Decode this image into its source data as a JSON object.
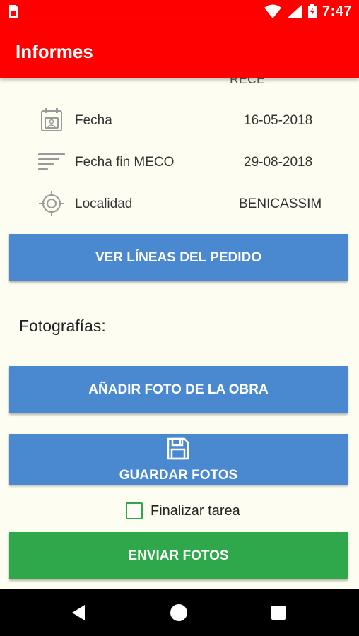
{
  "status_bar": {
    "time": "7:47",
    "icons": [
      "sim-card-icon",
      "wifi-icon",
      "signal-icon",
      "battery-icon"
    ]
  },
  "app_bar": {
    "title": "Informes"
  },
  "partial_text": "RECE",
  "details": [
    {
      "icon": "calendar-icon",
      "label": "Fecha",
      "value": "16-05-2018"
    },
    {
      "icon": "sort-lines-icon",
      "label": "Fecha fin MECO",
      "value": "29-08-2018"
    },
    {
      "icon": "location-target-icon",
      "label": "Localidad",
      "value": "BENICASSIM"
    }
  ],
  "buttons": {
    "ver_lineas": "VER LÍNEAS DEL PEDIDO",
    "anadir_foto": "AÑADIR FOTO DE LA OBRA",
    "guardar_fotos": "GUARDAR FOTOS",
    "enviar_fotos": "ENVIAR FOTOS"
  },
  "photos_section": {
    "title": "Fotografías:"
  },
  "finalizar": {
    "label": "Finalizar tarea",
    "checked": false
  },
  "colors": {
    "app_bar": "#ff0000",
    "background": "#fdfdf1",
    "button_blue": "#4a89d0",
    "button_green": "#2ea84a",
    "nav_bar": "#000000"
  },
  "nav_bar": {
    "buttons": [
      "back-icon",
      "home-icon",
      "recents-icon"
    ]
  }
}
